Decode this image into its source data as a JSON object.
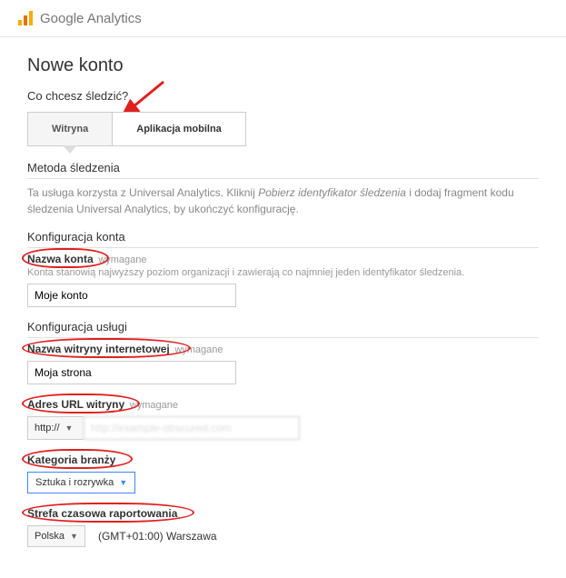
{
  "header": {
    "brand1": "Google",
    "brand2": " Analytics"
  },
  "page_title": "Nowe konto",
  "tracking_question": "Co chcesz śledzić?",
  "tabs": {
    "website": "Witryna",
    "mobile": "Aplikacja mobilna"
  },
  "method": {
    "title": "Metoda śledzenia",
    "desc_prefix": "Ta usługa korzysta z Universal Analytics. Kliknij ",
    "desc_em": "Pobierz identyfikator śledzenia",
    "desc_suffix": " i dodaj fragment kodu śledzenia Universal Analytics, by ukończyć konfigurację."
  },
  "account_config": {
    "title": "Konfiguracja konta",
    "name_label": "Nazwa konta",
    "required": "wymagane",
    "hint": "Konta stanowią najwyższy poziom organizacji i zawierają co najmniej jeden identyfikator śledzenia.",
    "value": "Moje konto"
  },
  "service_config": {
    "title": "Konfiguracja usługi",
    "site_name_label": "Nazwa witryny internetowej",
    "site_name_value": "Moja strona",
    "url_label": "Adres URL witryny",
    "protocol": "http://",
    "url_value": "http://example-obscured.com",
    "category_label": "Kategoria branży",
    "category_value": "Sztuka i rozrywka",
    "tz_label": "Strefa czasowa raportowania",
    "tz_country": "Polska",
    "tz_value": "(GMT+01:00) Warszawa"
  }
}
